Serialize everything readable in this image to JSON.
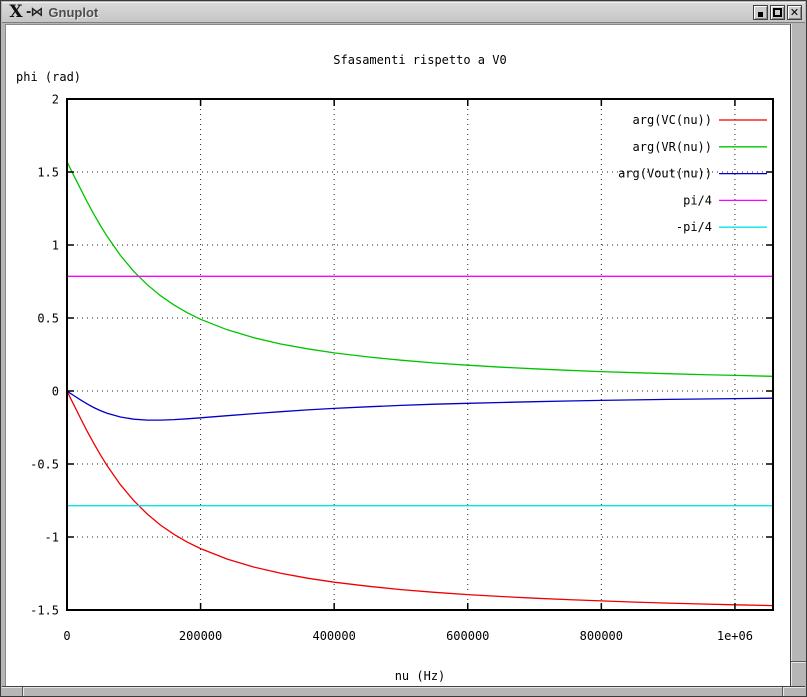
{
  "window": {
    "title": "Gnuplot",
    "logo_glyph": "X",
    "pin_glyph": "-⋈",
    "close_glyph": "✕"
  },
  "chart_data": {
    "type": "line",
    "title": "Sfasamenti rispetto a V0",
    "xlabel": "nu (Hz)",
    "ylabel": "phi (rad)",
    "xlim": [
      0,
      1057000
    ],
    "ylim": [
      -1.5,
      2
    ],
    "grid": true,
    "legend_position": "top-right-inside",
    "xticks": {
      "values": [
        0,
        200000,
        400000,
        600000,
        800000,
        1000000
      ],
      "labels": [
        "0",
        "200000",
        "400000",
        "600000",
        "800000",
        "1e+06"
      ]
    },
    "yticks": {
      "values": [
        2,
        1.5,
        1,
        0.5,
        0,
        -0.5,
        -1,
        -1.5
      ],
      "labels": [
        "2",
        "1.5",
        "1",
        "0.5",
        "0",
        "-0.5",
        "-1",
        "-1.5"
      ]
    },
    "x": [
      0,
      5000,
      10000,
      20000,
      30000,
      40000,
      50000,
      60000,
      80000,
      100000,
      120000,
      140000,
      160000,
      180000,
      200000,
      240000,
      280000,
      320000,
      360000,
      400000,
      450000,
      500000,
      550000,
      600000,
      650000,
      700000,
      750000,
      800000,
      850000,
      900000,
      950000,
      1000000,
      1057000
    ],
    "series": [
      {
        "name": "arg(VC(nu))",
        "color": "#ee0000",
        "y": [
          0,
          -0.0467,
          -0.0932,
          -0.1848,
          -0.2733,
          -0.3577,
          -0.4371,
          -0.5111,
          -0.642,
          -0.7516,
          -0.8426,
          -0.9182,
          -0.9814,
          -1.0348,
          -1.0797,
          -1.1517,
          -1.2063,
          -1.2487,
          -1.2819,
          -1.3095,
          -1.3373,
          -1.36,
          -1.3787,
          -1.3944,
          -1.4077,
          -1.419,
          -1.429,
          -1.4378,
          -1.4456,
          -1.4525,
          -1.4586,
          -1.4642,
          -1.4699
        ]
      },
      {
        "name": "arg(VR(nu))",
        "color": "#00c400",
        "y": [
          1.5708,
          1.5241,
          1.4776,
          1.386,
          1.2975,
          1.2131,
          1.1337,
          1.0597,
          0.9288,
          0.8192,
          0.7282,
          0.6526,
          0.5894,
          0.536,
          0.4911,
          0.4191,
          0.3645,
          0.3221,
          0.2889,
          0.2613,
          0.2335,
          0.2108,
          0.1921,
          0.1764,
          0.1631,
          0.1518,
          0.1418,
          0.133,
          0.1252,
          0.1183,
          0.1122,
          0.1066,
          0.1009
        ]
      },
      {
        "name": "arg(Vout(nu))",
        "color": "#0000c8",
        "y": [
          0,
          -0.0155,
          -0.0308,
          -0.0604,
          -0.0879,
          -0.1127,
          -0.1343,
          -0.1523,
          -0.1784,
          -0.193,
          -0.1991,
          -0.1994,
          -0.196,
          -0.1906,
          -0.1836,
          -0.1689,
          -0.1546,
          -0.1416,
          -0.1293,
          -0.1192,
          -0.1084,
          -0.0989,
          -0.0907,
          -0.0842,
          -0.0785,
          -0.0731,
          -0.0684,
          -0.0644,
          -0.0609,
          -0.0577,
          -0.0547,
          -0.0521,
          -0.0493
        ]
      },
      {
        "name": "pi/4",
        "color": "#ff00ff",
        "const": 0.7854
      },
      {
        "name": "-pi/4",
        "color": "#00e8e8",
        "const": -0.7854
      }
    ]
  }
}
